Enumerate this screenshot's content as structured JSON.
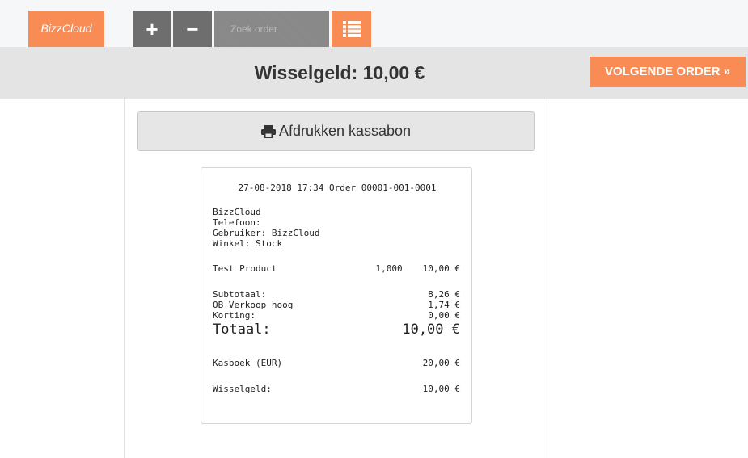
{
  "topbar": {
    "brand": "BizzCloud",
    "add_glyph": "+",
    "remove_glyph": "−",
    "search_placeholder": "Zoek order",
    "list_icon": "list-icon"
  },
  "header": {
    "change_title": "Wisselgeld: 10,00 €",
    "next_order": "VOLGENDE ORDER »"
  },
  "print": {
    "label": "Afdrukken kassabon",
    "icon": "printer-icon"
  },
  "receipt": {
    "header": "27-08-2018 17:34 Order 00001-001-0001",
    "company": "BizzCloud",
    "phone": "Telefoon:",
    "user": "Gebruiker: BizzCloud",
    "store": "Winkel: Stock",
    "items": [
      {
        "name": "Test Product",
        "qty": "1,000",
        "price": "10,00 €"
      }
    ],
    "subtotal_label": "Subtotaal:",
    "subtotal_value": "8,26 €",
    "vat_label": "OB Verkoop hoog",
    "vat_value": "1,74 €",
    "discount_label": "Korting:",
    "discount_value": "0,00 €",
    "total_label": "Totaal:",
    "total_value": "10,00 €",
    "cashbook_label": "Kasboek (EUR)",
    "cashbook_value": "20,00 €",
    "change_label": "Wisselgeld:",
    "change_value": "10,00 €"
  },
  "colors": {
    "accent": "#f98c55",
    "button_dark": "#6e6e6e",
    "header_bg": "#e4e4e4"
  }
}
